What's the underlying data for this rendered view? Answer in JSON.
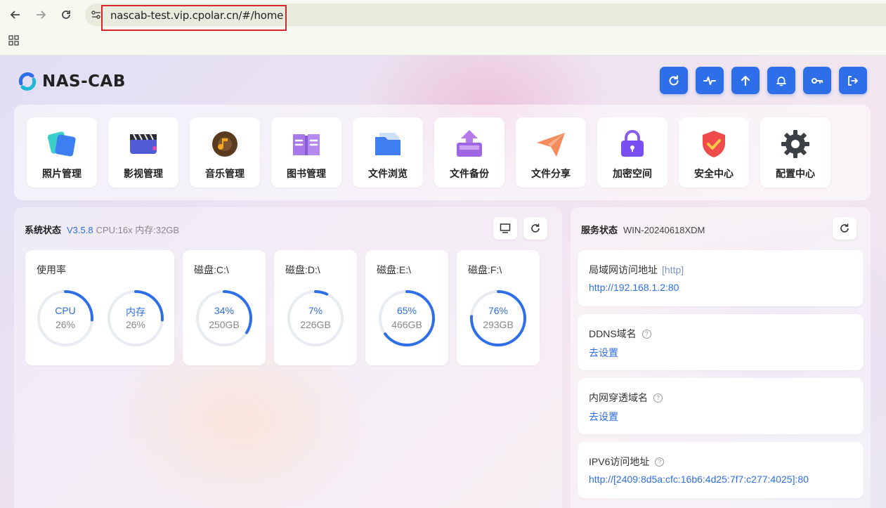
{
  "browser": {
    "url": "nascab-test.vip.cpolar.cn/#/home"
  },
  "logo": {
    "text": "NAS-CAB"
  },
  "colors": {
    "accent": "#2e6ee8",
    "track": "#e8ebf1"
  },
  "top_actions": [
    {
      "name": "refresh-button",
      "icon": "refresh-icon"
    },
    {
      "name": "activity-button",
      "icon": "pulse-icon"
    },
    {
      "name": "upload-button",
      "icon": "arrow-up-icon"
    },
    {
      "name": "notification-button",
      "icon": "bell-icon"
    },
    {
      "name": "key-button",
      "icon": "key-icon"
    },
    {
      "name": "logout-button",
      "icon": "logout-icon"
    }
  ],
  "apps": [
    {
      "label": "照片管理",
      "icon": "photo-icon"
    },
    {
      "label": "影视管理",
      "icon": "video-icon"
    },
    {
      "label": "音乐管理",
      "icon": "music-icon"
    },
    {
      "label": "图书管理",
      "icon": "book-icon"
    },
    {
      "label": "文件浏览",
      "icon": "folder-icon"
    },
    {
      "label": "文件备份",
      "icon": "backup-icon"
    },
    {
      "label": "文件分享",
      "icon": "share-icon"
    },
    {
      "label": "加密空间",
      "icon": "lock-icon"
    },
    {
      "label": "安全中心",
      "icon": "shield-icon"
    },
    {
      "label": "配置中心",
      "icon": "gear-icon"
    }
  ],
  "system": {
    "title": "系统状态",
    "version": "V3.5.8",
    "spec": "CPU:16x 内存:32GB",
    "usage": {
      "title": "使用率",
      "gauges": [
        {
          "label": "CPU",
          "percent_text": "26%",
          "fraction": 0.26
        },
        {
          "label": "内存",
          "percent_text": "26%",
          "fraction": 0.26
        }
      ]
    },
    "disks": [
      {
        "title": "磁盘:C:\\",
        "percent_text": "34%",
        "size": "250GB",
        "fraction": 0.34
      },
      {
        "title": "磁盘:D:\\",
        "percent_text": "7%",
        "size": "226GB",
        "fraction": 0.07
      },
      {
        "title": "磁盘:E:\\",
        "percent_text": "65%",
        "size": "466GB",
        "fraction": 0.65
      },
      {
        "title": "磁盘:F:\\",
        "percent_text": "76%",
        "size": "293GB",
        "fraction": 0.76
      }
    ]
  },
  "service": {
    "title": "服务状态",
    "host": "WIN-20240618XDM",
    "items": [
      {
        "label": "局域网访问地址",
        "proto": "[http]",
        "value": "http://192.168.1.2:80"
      },
      {
        "label": "DDNS域名",
        "help": "?",
        "value": "去设置"
      },
      {
        "label": "内网穿透域名",
        "help": "?",
        "value": "去设置"
      },
      {
        "label": "IPV6访问地址",
        "help": "?",
        "value": "http://[2409:8d5a:cfc:16b6:4d25:7f7:c277:4025]:80"
      }
    ]
  }
}
